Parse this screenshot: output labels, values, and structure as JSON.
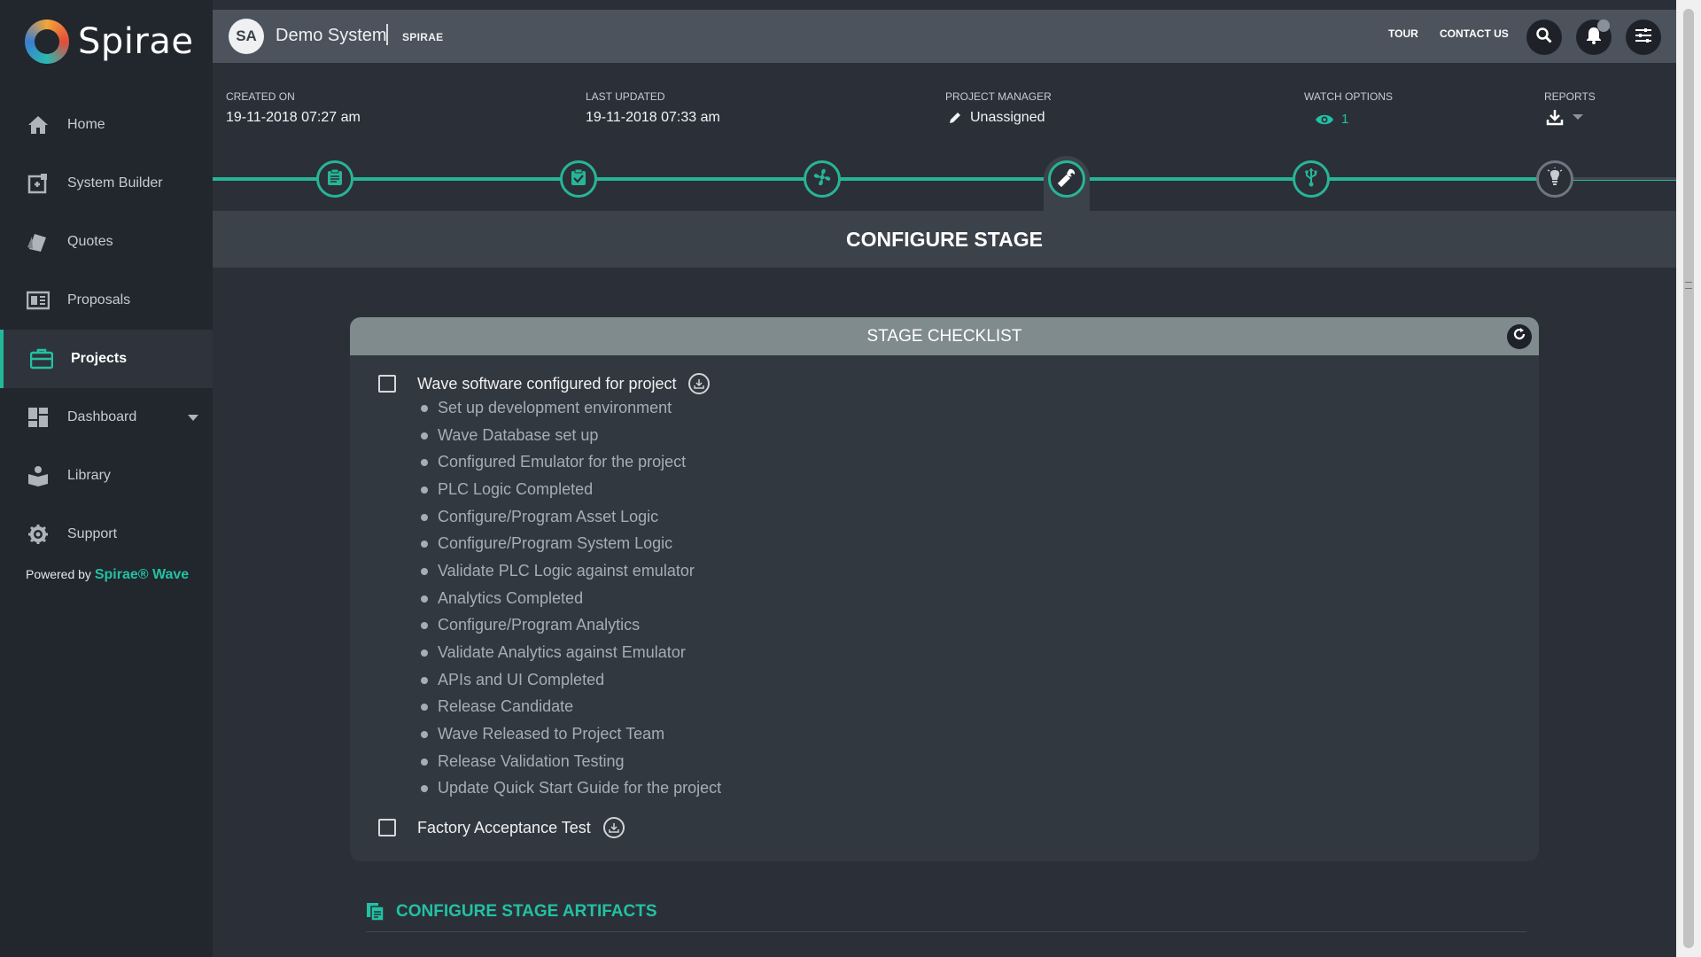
{
  "brand": {
    "name": "Spirae"
  },
  "sidebar": {
    "items": [
      {
        "label": "Home",
        "icon": "home-icon"
      },
      {
        "label": "System Builder",
        "icon": "system-builder-icon"
      },
      {
        "label": "Quotes",
        "icon": "quotes-icon"
      },
      {
        "label": "Proposals",
        "icon": "proposals-icon"
      },
      {
        "label": "Projects",
        "icon": "briefcase-icon",
        "active": true
      },
      {
        "label": "Dashboard",
        "icon": "dashboard-icon",
        "has_dropdown": true
      },
      {
        "label": "Library",
        "icon": "library-icon"
      },
      {
        "label": "Support",
        "icon": "gear-icon"
      }
    ],
    "powered_prefix": "Powered by",
    "powered_brand": "Spirae® Wave"
  },
  "header": {
    "avatar_initials": "SA",
    "system_name": "Demo System",
    "brand_tag": "SPIRAE",
    "tour": "TOUR",
    "contact": "CONTACT US"
  },
  "meta": {
    "created_label": "CREATED ON",
    "created_value": "19-11-2018 07:27 am",
    "updated_label": "LAST UPDATED",
    "updated_value": "19-11-2018 07:33 am",
    "manager_label": "PROJECT MANAGER",
    "manager_value": "Unassigned",
    "watch_label": "WATCH OPTIONS",
    "watch_count": "1",
    "reports_label": "REPORTS"
  },
  "stages": [
    {
      "icon": "clipboard-icon",
      "state": "done"
    },
    {
      "icon": "clipboard-check-icon",
      "state": "done"
    },
    {
      "icon": "fan-icon",
      "state": "done"
    },
    {
      "icon": "wrench-icon",
      "state": "current"
    },
    {
      "icon": "usb-icon",
      "state": "done"
    },
    {
      "icon": "lightbulb-icon",
      "state": "future"
    }
  ],
  "stage_title": "CONFIGURE STAGE",
  "checklist": {
    "title": "STAGE CHECKLIST",
    "groups": [
      {
        "label": "Wave software configured for project",
        "items": [
          "Set up development environment",
          "Wave Database set up",
          "Configured Emulator for the project",
          "PLC Logic Completed",
          "Configure/Program Asset Logic",
          "Configure/Program System Logic",
          "Validate PLC Logic against emulator",
          "Analytics Completed",
          "Configure/Program Analytics",
          "Validate Analytics against Emulator",
          "APIs and UI Completed",
          "Release Candidate",
          "Wave Released to Project Team",
          "Release Validation Testing",
          "Update Quick Start Guide for the project"
        ]
      },
      {
        "label": "Factory Acceptance Test",
        "items": []
      }
    ]
  },
  "artifacts_title": "CONFIGURE STAGE ARTIFACTS",
  "colors": {
    "accent": "#27b597",
    "sidebar_bg": "#22262d",
    "page_bg": "#2b3038",
    "header_bg": "#4c535c"
  }
}
